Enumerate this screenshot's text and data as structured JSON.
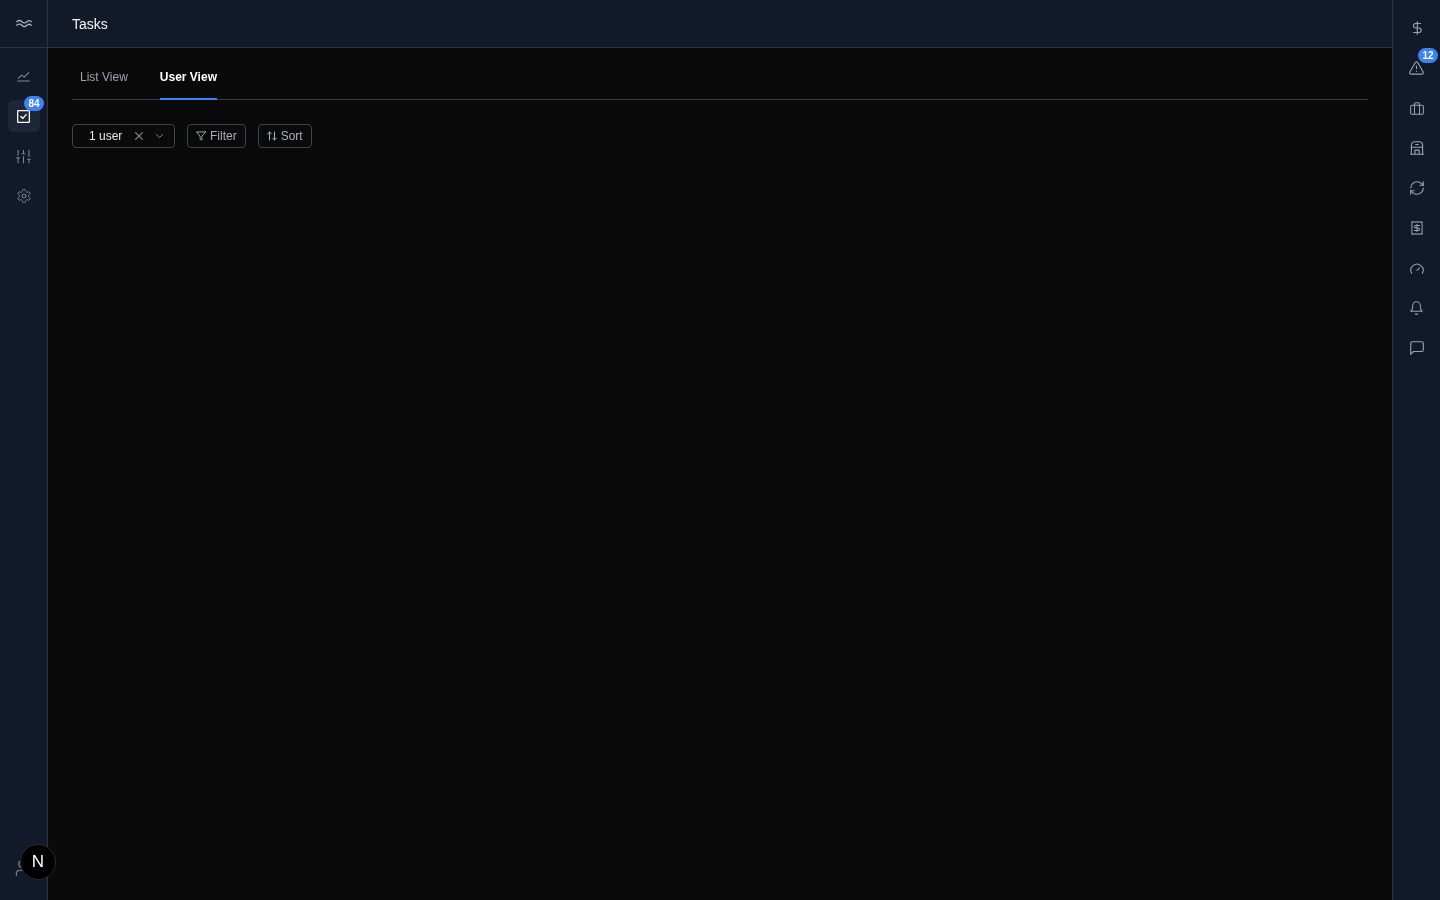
{
  "left_sidebar": {
    "items": [
      {
        "kind": "chart",
        "selected": false
      },
      {
        "kind": "check",
        "selected": true,
        "badge": "84"
      },
      {
        "kind": "sliders",
        "selected": false
      },
      {
        "kind": "gear",
        "selected": false
      }
    ]
  },
  "header": {
    "title": "Tasks"
  },
  "tabs": [
    {
      "label": "List View",
      "selected": false
    },
    {
      "label": "User View",
      "selected": true
    }
  ],
  "toolbar": {
    "user_select": {
      "value": "1 user"
    },
    "buttons": [
      {
        "kind": "filter",
        "label": "Filter"
      },
      {
        "kind": "sort",
        "label": "Sort"
      }
    ]
  },
  "right_sidebar": {
    "items": [
      {
        "kind": "dollar"
      },
      {
        "kind": "alert",
        "badge": "12"
      },
      {
        "kind": "briefcase"
      },
      {
        "kind": "building"
      },
      {
        "kind": "refresh"
      },
      {
        "kind": "receipt"
      },
      {
        "kind": "gauge"
      },
      {
        "kind": "bell"
      },
      {
        "kind": "message"
      }
    ]
  },
  "dev_indicator": {
    "label": "N"
  }
}
